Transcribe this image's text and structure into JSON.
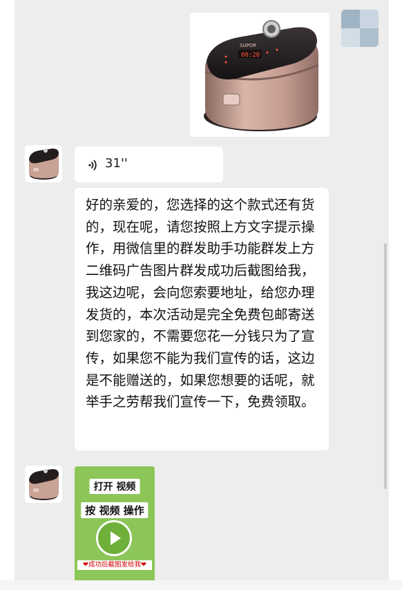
{
  "chat": {
    "product_image": {
      "brand_text": "SUPOR",
      "display_text": "00:20"
    },
    "voice_message": {
      "duration": "31''"
    },
    "text_message": "好的亲爱的，您选择的这个款式还有货的，现在呢，请您按照上方文字提示操作，用微信里的群发助手功能群发上方二维码广告图片群发成功后截图给我，我这边呢，会向您索要地址，给您办理发货的，本次活动是完全免费包邮寄送到您家的，不需要您花一分钱只为了宣传，如果您不能为我们宣传的话，这边是不能赠送的，如果您想要的话呢，就举手之劳帮我们宣传一下，免费领取。",
    "video_card": {
      "label_line1": "打开 视频",
      "label_line2": "按 视频 操作",
      "caption": "❤成功后截图发给我❤"
    }
  },
  "colors": {
    "chat_background": "#ededed",
    "bubble_background": "#ffffff",
    "video_card_green": "#8cc659",
    "caption_red": "#d10000"
  },
  "icons": [
    "voice-wave-icon",
    "play-icon"
  ]
}
